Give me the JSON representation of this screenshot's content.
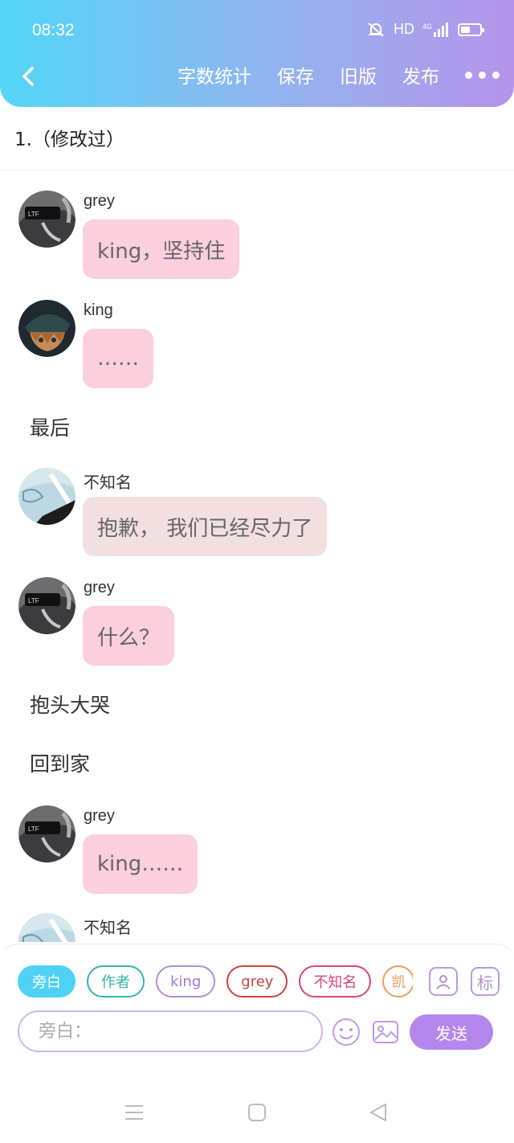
{
  "status_bar": {
    "time": "08:32",
    "network": "HD",
    "signal_label": "4G"
  },
  "header": {
    "back_icon": "chevron-left-icon",
    "actions": {
      "word_count": "字数统计",
      "save": "保存",
      "old_version": "旧版",
      "publish": "发布"
    },
    "more_icon": "more-dots-icon",
    "accent_gradient": [
      "#52d6f7",
      "#b594ea"
    ]
  },
  "chapter": {
    "title": "1.（修改过）"
  },
  "messages": [
    {
      "type": "chat",
      "speaker": "grey",
      "text": "king，坚持住",
      "avatar": "grey"
    },
    {
      "type": "chat",
      "speaker": "king",
      "text": "……",
      "avatar": "king"
    },
    {
      "type": "narration",
      "text": "最后"
    },
    {
      "type": "chat",
      "speaker": "不知名",
      "text": "抱歉， 我们已经尽力了",
      "avatar": "unknown"
    },
    {
      "type": "chat",
      "speaker": "grey",
      "text": "什么？",
      "avatar": "grey"
    },
    {
      "type": "narration",
      "text": "抱头大哭"
    },
    {
      "type": "narration",
      "text": "回到家"
    },
    {
      "type": "chat",
      "speaker": "grey",
      "text": "king……",
      "avatar": "grey"
    },
    {
      "type": "chat",
      "speaker": "不知名",
      "text": "",
      "avatar": "unknown"
    }
  ],
  "composer": {
    "roles": [
      {
        "label": "旁白",
        "active": true
      },
      {
        "label": "作者"
      },
      {
        "label": "king"
      },
      {
        "label": "grey"
      },
      {
        "label": "不知名"
      },
      {
        "label": "凯"
      }
    ],
    "role_manager_icon": "person-card-icon",
    "tag_button": "标",
    "input_placeholder": "旁白：",
    "emoji_icon": "emoji-icon",
    "image_icon": "image-icon",
    "send_label": "发送"
  },
  "system_nav": {
    "menu_icon": "menu-icon",
    "home_icon": "home-square-icon",
    "back_icon": "back-triangle-icon"
  },
  "colors": {
    "bubble_pink": "#fccfdc",
    "bubble_beige": "#f2e0e0",
    "send": "#b487ec",
    "active_chip": "#4fd0f5"
  }
}
